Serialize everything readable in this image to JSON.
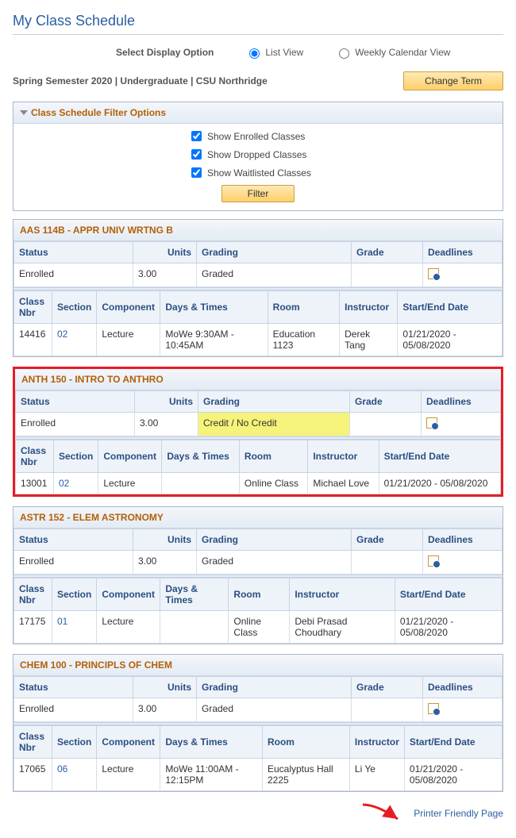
{
  "page_title": "My Class Schedule",
  "display_option": {
    "label": "Select Display Option",
    "list_view": "List View",
    "calendar_view": "Weekly Calendar View",
    "selected": "list"
  },
  "term_label": "Spring Semester 2020 | Undergraduate | CSU Northridge",
  "change_term_btn": "Change Term",
  "filter": {
    "header": "Class Schedule Filter Options",
    "show_enrolled": "Show Enrolled Classes",
    "show_dropped": "Show Dropped Classes",
    "show_waitlisted": "Show Waitlisted Classes",
    "filter_btn": "Filter"
  },
  "headers": {
    "status": "Status",
    "units": "Units",
    "grading": "Grading",
    "grade": "Grade",
    "deadlines": "Deadlines",
    "class_nbr": "Class Nbr",
    "section": "Section",
    "component": "Component",
    "days_times": "Days & Times",
    "room": "Room",
    "instructor": "Instructor",
    "start_end": "Start/End Date"
  },
  "classes": [
    {
      "title": "AAS 114B - APPR UNIV WRTNG B",
      "highlight": false,
      "grading_highlight": false,
      "status": "Enrolled",
      "units": "3.00",
      "grading": "Graded",
      "grade": "",
      "class_nbr": "14416",
      "section": "02",
      "component": "Lecture",
      "days_times": "MoWe 9:30AM - 10:45AM",
      "room": "Education 1123",
      "instructor": "Derek Tang",
      "start_end": "01/21/2020 - 05/08/2020"
    },
    {
      "title": "ANTH 150 - INTRO TO ANTHRO",
      "highlight": true,
      "grading_highlight": true,
      "status": "Enrolled",
      "units": "3.00",
      "grading": "Credit / No Credit",
      "grade": "",
      "class_nbr": "13001",
      "section": "02",
      "component": "Lecture",
      "days_times": "",
      "room": "Online Class",
      "instructor": "Michael Love",
      "start_end": "01/21/2020 - 05/08/2020"
    },
    {
      "title": "ASTR 152 - ELEM ASTRONOMY",
      "highlight": false,
      "grading_highlight": false,
      "status": "Enrolled",
      "units": "3.00",
      "grading": "Graded",
      "grade": "",
      "class_nbr": "17175",
      "section": "01",
      "component": "Lecture",
      "days_times": "",
      "room": "Online Class",
      "instructor": "Debi Prasad Choudhary",
      "start_end": "01/21/2020 - 05/08/2020"
    },
    {
      "title": "CHEM 100 - PRINCIPLS OF CHEM",
      "highlight": false,
      "grading_highlight": false,
      "status": "Enrolled",
      "units": "3.00",
      "grading": "Graded",
      "grade": "",
      "class_nbr": "17065",
      "section": "06",
      "component": "Lecture",
      "days_times": "MoWe 11:00AM - 12:15PM",
      "room": "Eucalyptus Hall 2225",
      "instructor": "Li Ye",
      "start_end": "01/21/2020 - 05/08/2020"
    }
  ],
  "printer_link": "Printer Friendly Page"
}
